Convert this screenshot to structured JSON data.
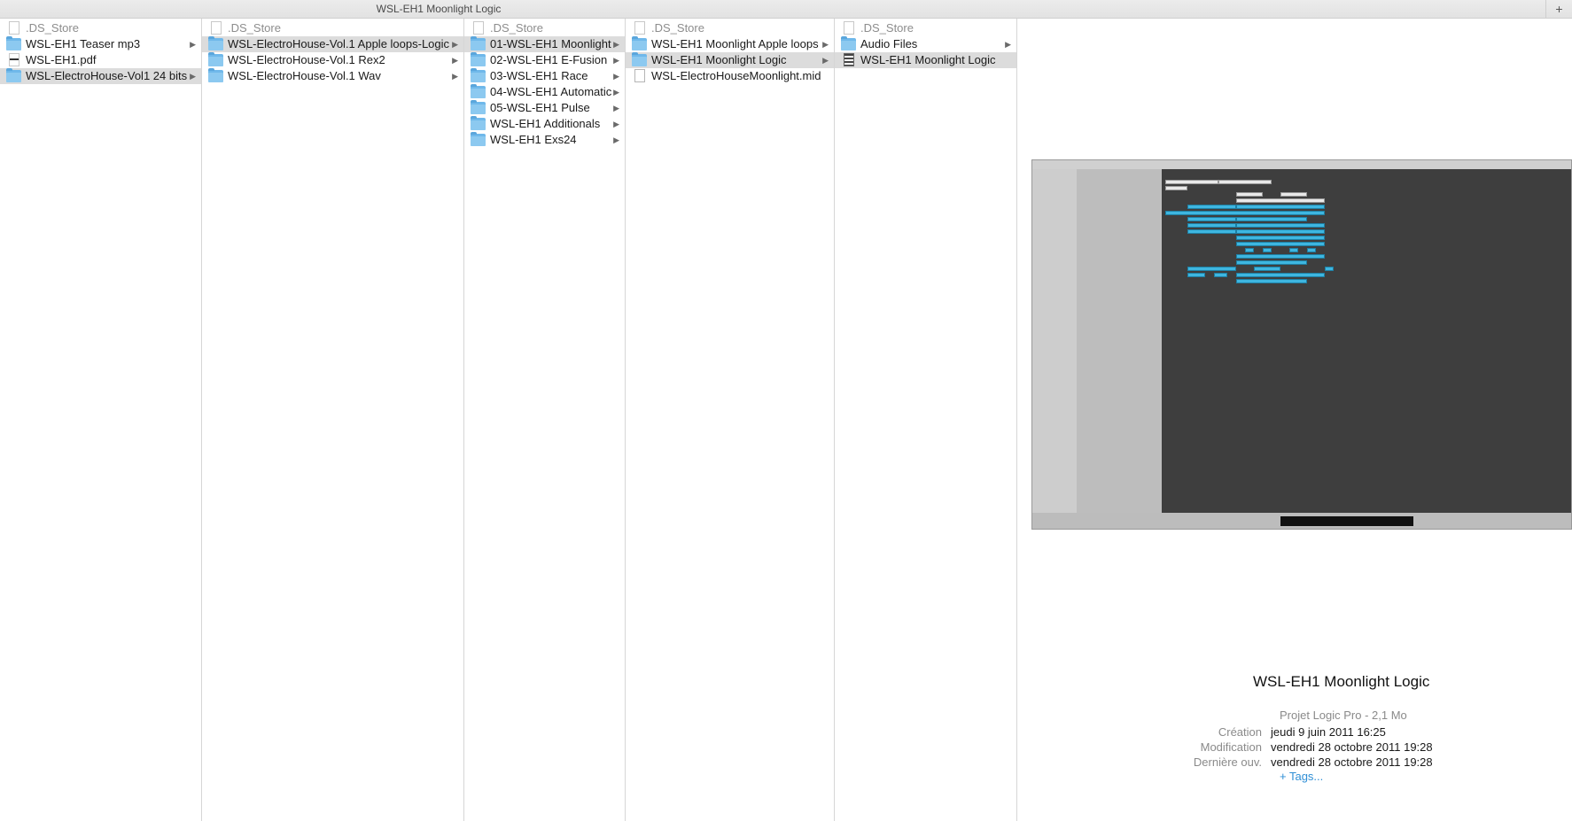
{
  "window": {
    "title": "WSL-EH1 Moonlight Logic",
    "add_tab_label": "+"
  },
  "columns": [
    {
      "items": [
        {
          "label": ".DS_Store",
          "icon": "file-icon",
          "dim": true
        },
        {
          "label": "WSL-EH1 Teaser mp3",
          "icon": "folder-icon",
          "arrow": true
        },
        {
          "label": "WSL-EH1.pdf",
          "icon": "pdf-icon"
        },
        {
          "label": "WSL-ElectroHouse-Vol1 24 bits",
          "icon": "folder-icon",
          "arrow": true,
          "selected": true
        }
      ]
    },
    {
      "items": [
        {
          "label": ".DS_Store",
          "icon": "file-icon",
          "dim": true
        },
        {
          "label": "WSL-ElectroHouse-Vol.1 Apple loops-Logic",
          "icon": "folder-icon",
          "arrow": true,
          "selected": true
        },
        {
          "label": "WSL-ElectroHouse-Vol.1 Rex2",
          "icon": "folder-icon",
          "arrow": true
        },
        {
          "label": "WSL-ElectroHouse-Vol.1 Wav",
          "icon": "folder-icon",
          "arrow": true
        }
      ]
    },
    {
      "items": [
        {
          "label": ".DS_Store",
          "icon": "file-icon",
          "dim": true
        },
        {
          "label": "01-WSL-EH1 Moonlight",
          "icon": "folder-icon",
          "arrow": true,
          "selected": true
        },
        {
          "label": "02-WSL-EH1 E-Fusion",
          "icon": "folder-icon",
          "arrow": true
        },
        {
          "label": "03-WSL-EH1 Race",
          "icon": "folder-icon",
          "arrow": true
        },
        {
          "label": "04-WSL-EH1 Automatic",
          "icon": "folder-icon",
          "arrow": true
        },
        {
          "label": "05-WSL-EH1 Pulse",
          "icon": "folder-icon",
          "arrow": true
        },
        {
          "label": "WSL-EH1 Additionals",
          "icon": "folder-icon",
          "arrow": true
        },
        {
          "label": "WSL-EH1 Exs24",
          "icon": "folder-icon",
          "arrow": true
        }
      ]
    },
    {
      "items": [
        {
          "label": ".DS_Store",
          "icon": "file-icon",
          "dim": true
        },
        {
          "label": "WSL-EH1 Moonlight Apple loops",
          "icon": "folder-icon",
          "arrow": true
        },
        {
          "label": "WSL-EH1 Moonlight Logic",
          "icon": "folder-icon",
          "arrow": true,
          "selected": true
        },
        {
          "label": "WSL-ElectroHouseMoonlight.mid",
          "icon": "midi-file-icon"
        }
      ]
    },
    {
      "items": [
        {
          "label": ".DS_Store",
          "icon": "file-icon",
          "dim": true
        },
        {
          "label": "Audio Files",
          "icon": "folder-icon",
          "arrow": true
        },
        {
          "label": "WSL-EH1 Moonlight Logic",
          "icon": "logic-project-icon",
          "selected": true
        }
      ]
    }
  ],
  "preview": {
    "name": "WSL-EH1 Moonlight Logic",
    "kind": "Projet Logic Pro - 2,1 Mo",
    "details": [
      {
        "key": "Création",
        "value": "jeudi 9 juin 2011 16:25"
      },
      {
        "key": "Modification",
        "value": "vendredi 28 octobre 2011 19:28"
      },
      {
        "key": "Dernière ouv.",
        "value": "vendredi 28 octobre 2011 19:28"
      }
    ],
    "tags_link": "+ Tags..."
  }
}
